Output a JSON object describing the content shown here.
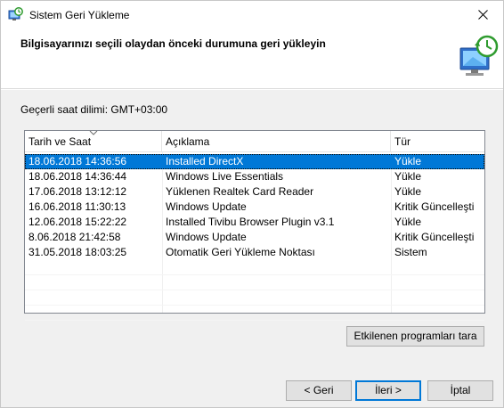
{
  "window": {
    "title": "Sistem Geri Yükleme"
  },
  "header": {
    "title": "Bilgisayarınızı seçili olaydan önceki durumuna geri yükleyin"
  },
  "timezone": "Geçerli saat dilimi: GMT+03:00",
  "list": {
    "columns": [
      "Tarih ve Saat",
      "Açıklama",
      "Tür"
    ],
    "rows": [
      {
        "date": "18.06.2018 14:36:56",
        "desc": "Installed DirectX",
        "type": "Yükle",
        "selected": true
      },
      {
        "date": "18.06.2018 14:36:44",
        "desc": "Windows Live Essentials",
        "type": "Yükle"
      },
      {
        "date": "17.06.2018 13:12:12",
        "desc": "Yüklenen Realtek Card Reader",
        "type": "Yükle"
      },
      {
        "date": "16.06.2018 11:30:13",
        "desc": "Windows Update",
        "type": "Kritik Güncelleşti"
      },
      {
        "date": "12.06.2018 15:22:22",
        "desc": "Installed Tivibu Browser Plugin v3.1",
        "type": "Yükle"
      },
      {
        "date": "8.06.2018 21:42:58",
        "desc": "Windows Update",
        "type": "Kritik Güncelleşti"
      },
      {
        "date": "31.05.2018 18:03:25",
        "desc": "Otomatik Geri Yükleme Noktası",
        "type": "Sistem"
      }
    ]
  },
  "buttons": {
    "scan": "Etkilenen programları tara",
    "back": "< Geri",
    "next": "İleri >",
    "cancel": "İptal"
  },
  "colors": {
    "selection": "#0078d7",
    "panel": "#f0f0f0"
  },
  "icons": {
    "title": "system-restore-icon",
    "header": "system-restore-monitor-icon",
    "close": "close-icon"
  }
}
